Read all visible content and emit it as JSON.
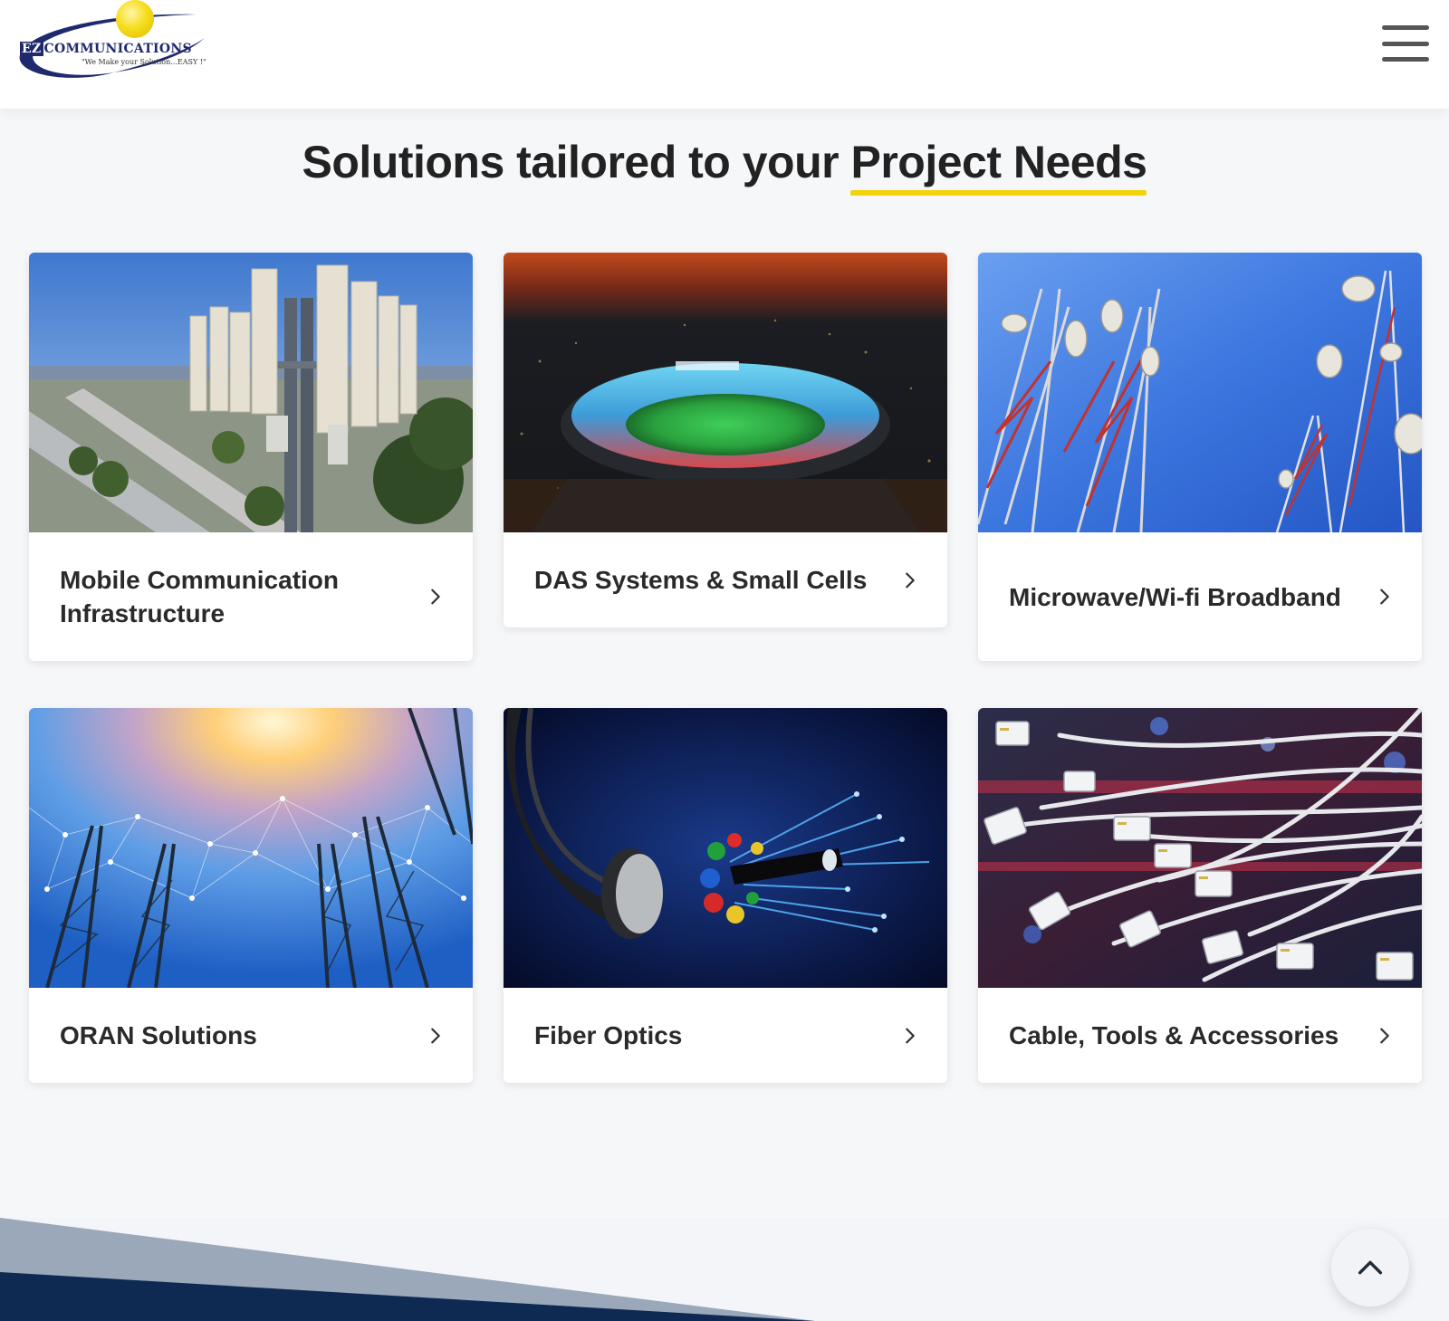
{
  "header": {
    "logo": {
      "ez": "EZ",
      "name": "COMMUNICATIONS",
      "tagline": "\"We Make your Solution...EASY !\""
    },
    "menu_icon": "hamburger-menu-icon"
  },
  "headline": {
    "text_regular": "Solutions tailored to your ",
    "text_emphasis": "Project Needs",
    "underline_color": "#f5d20a"
  },
  "cards": [
    {
      "title": "Mobile Communication Infrastructure",
      "image": "cell-tower-antennas-photo",
      "icon": "chevron-right-icon"
    },
    {
      "title": "DAS Systems & Small Cells",
      "image": "stadium-at-night-photo",
      "icon": "chevron-right-icon"
    },
    {
      "title": "Microwave/Wi-fi Broadband",
      "image": "microwave-towers-blue-sky-photo",
      "icon": "chevron-right-icon"
    },
    {
      "title": "ORAN Solutions",
      "image": "network-towers-sunlight-photo",
      "icon": "chevron-right-icon"
    },
    {
      "title": "Fiber Optics",
      "image": "fiber-optic-cable-photo",
      "icon": "chevron-right-icon"
    },
    {
      "title": "Cable, Tools & Accessories",
      "image": "ethernet-cables-photo",
      "icon": "chevron-right-icon"
    }
  ],
  "back_to_top": {
    "icon": "chevron-up-icon"
  },
  "colors": {
    "brand_navy": "#1f2a6e",
    "accent_yellow": "#f5d20a",
    "page_bg": "#f6f7f9",
    "footer_navy": "#0f2a52"
  }
}
